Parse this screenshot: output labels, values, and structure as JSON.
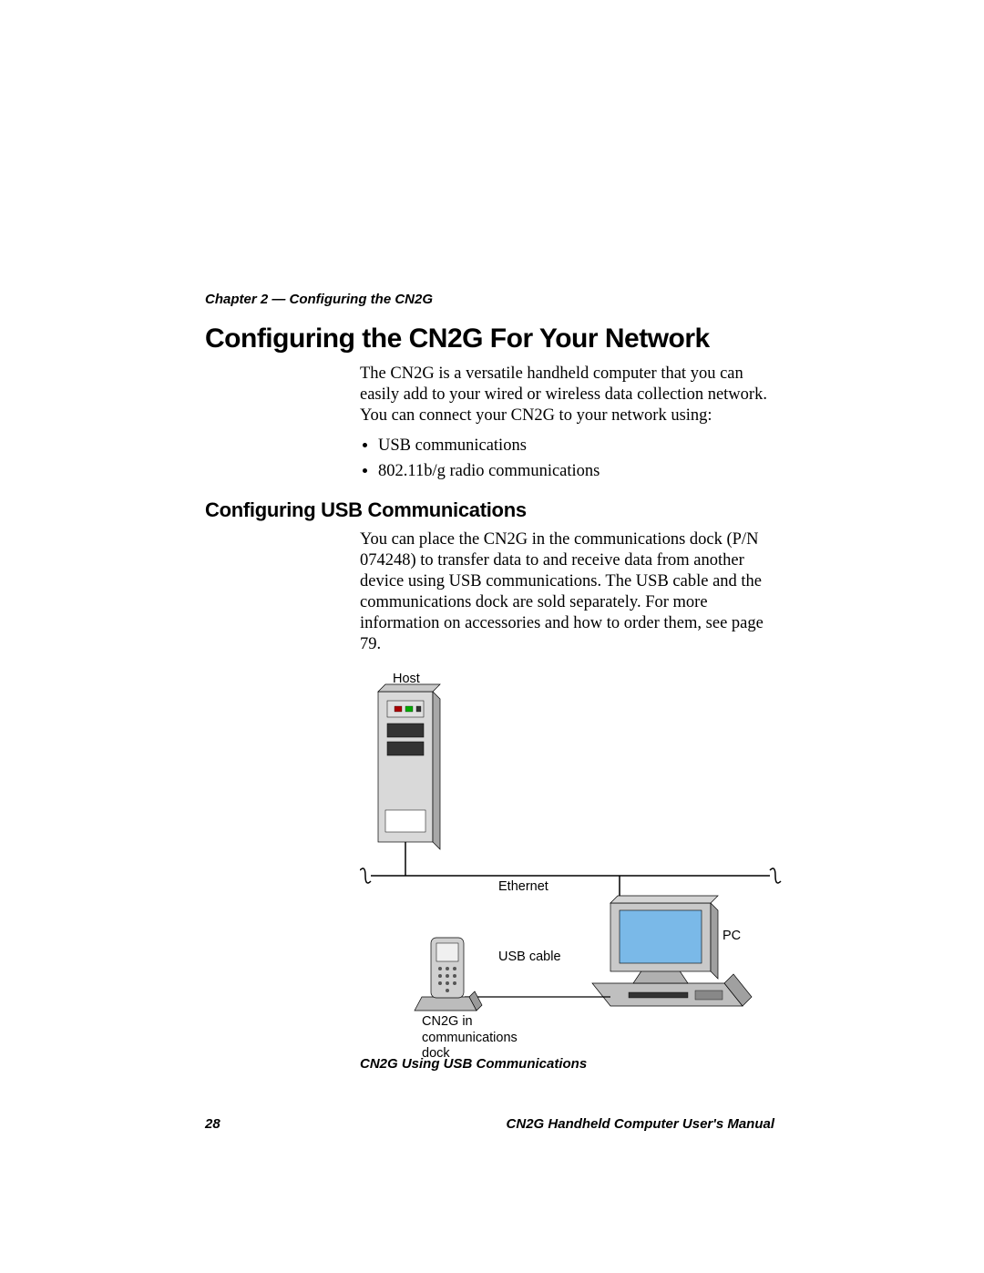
{
  "chapter_label": "Chapter 2 — Configuring the CN2G",
  "heading1": "Configuring the CN2G For Your Network",
  "intro_para": "The CN2G is a versatile handheld computer that you can easily add to your wired or wireless data collection network. You can connect your CN2G to your network using:",
  "bullets": [
    "USB communications",
    "802.11b/g radio communications"
  ],
  "heading2": "Configuring USB Communications",
  "usb_para": "You can place the CN2G in the communications dock (P/N 074248) to transfer data to and receive data from another device using USB communications. The USB cable and the communications dock are sold separately. For more information on accessories and how to order them, see page 79.",
  "diagram": {
    "host": "Host",
    "ethernet": "Ethernet",
    "pc": "PC",
    "usb_cable": "USB cable",
    "cn2g_dock": "CN2G in communications dock"
  },
  "caption": "CN2G Using USB Communications",
  "footer": {
    "page_number": "28",
    "manual_title": "CN2G Handheld Computer User's Manual"
  }
}
